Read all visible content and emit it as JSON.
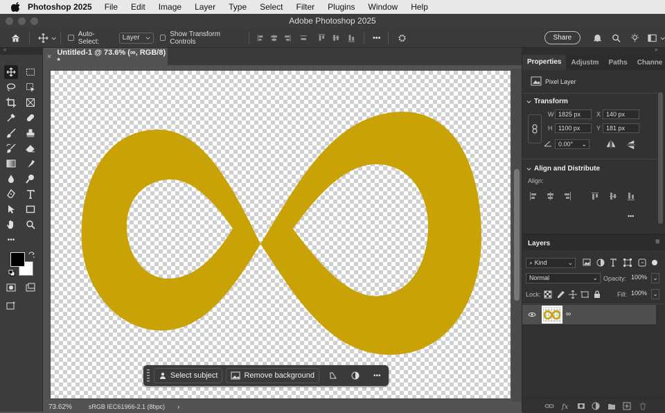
{
  "menubar": {
    "app_name": "Photoshop 2025",
    "items": [
      "File",
      "Edit",
      "Image",
      "Layer",
      "Type",
      "Select",
      "Filter",
      "Plugins",
      "Window",
      "Help"
    ]
  },
  "window": {
    "title": "Adobe Photoshop 2025"
  },
  "options_bar": {
    "auto_select_label": "Auto-Select:",
    "auto_select_value": "Layer",
    "show_transform_label": "Show Transform Controls",
    "more_label": "•••",
    "share_label": "Share"
  },
  "document": {
    "tab_title": "Untitled-1 @ 73.6% (∞, RGB/8) *",
    "fill_color": "#c9a206"
  },
  "context_bar": {
    "select_subject": "Select subject",
    "remove_background": "Remove background",
    "more": "•••"
  },
  "status": {
    "zoom": "73.62%",
    "profile": "sRGB IEC61966-2.1 (8bpc)"
  },
  "properties": {
    "tabs": [
      "Properties",
      "Adjustm",
      "Paths",
      "Channe"
    ],
    "layer_type": "Pixel Layer",
    "transform_title": "Transform",
    "w_label": "W",
    "w_value": "1825 px",
    "h_label": "H",
    "h_value": "1100 px",
    "x_label": "X",
    "x_value": "140 px",
    "y_label": "Y",
    "y_value": "181 px",
    "angle_value": "0.00°",
    "align_title": "Align and Distribute",
    "align_label": "Align:",
    "more": "•••"
  },
  "layers": {
    "title": "Layers",
    "filter_kind": "Kind",
    "blend_mode": "Normal",
    "opacity_label": "Opacity:",
    "opacity_value": "100%",
    "lock_label": "Lock:",
    "fill_label": "Fill:",
    "fill_value": "100%",
    "layer_name": "∞"
  },
  "colors": {
    "foreground": "#000000",
    "background": "#ffffff",
    "accent": "#c9a206"
  }
}
